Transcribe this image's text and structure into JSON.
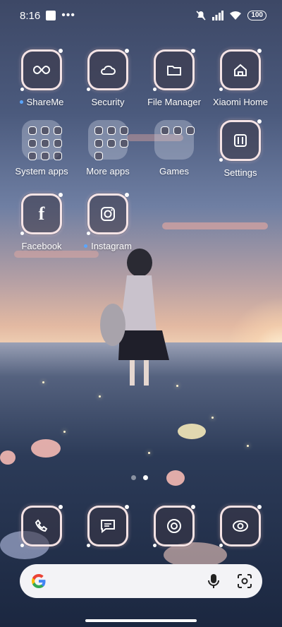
{
  "status": {
    "time": "8:16",
    "battery": "100"
  },
  "home_apps": [
    {
      "label": "ShareMe",
      "icon": "shareme-icon",
      "new_dot": true
    },
    {
      "label": "Security",
      "icon": "security-icon",
      "new_dot": false
    },
    {
      "label": "File Manager",
      "icon": "folder-icon",
      "new_dot": false
    },
    {
      "label": "Xiaomi Home",
      "icon": "home-icon",
      "new_dot": false
    },
    {
      "label": "System apps",
      "icon": "folder-grid-icon",
      "new_dot": false
    },
    {
      "label": "More apps",
      "icon": "folder-grid-icon",
      "new_dot": false
    },
    {
      "label": "Games",
      "icon": "folder-grid-icon",
      "new_dot": false
    },
    {
      "label": "Settings",
      "icon": "settings-icon",
      "new_dot": false
    },
    {
      "label": "Facebook",
      "icon": "facebook-icon",
      "new_dot": false
    },
    {
      "label": "Instagram",
      "icon": "instagram-icon",
      "new_dot": true
    }
  ],
  "pager": {
    "pages": 2,
    "current": 2
  },
  "dock": [
    "phone-icon",
    "messages-icon",
    "chrome-icon",
    "camera-icon"
  ],
  "colors": {
    "tile_border": "#ffecec",
    "badge_dot": "#5aa6ff",
    "search_bg": "#f3f3f6"
  }
}
